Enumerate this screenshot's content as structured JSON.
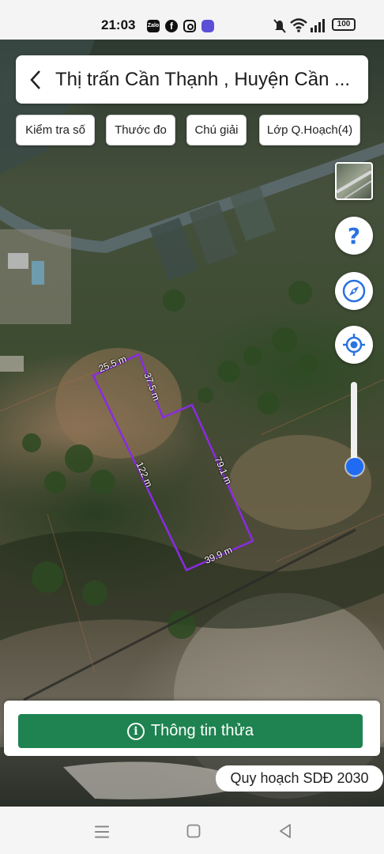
{
  "status_bar": {
    "time": "21:03",
    "app_icons": [
      "zalo-icon",
      "facebook-icon",
      "instagram-icon",
      "cloud-app-icon"
    ],
    "zalo_label": "Zalo",
    "battery": "100",
    "indicators": [
      "mute-icon",
      "wifi-icon",
      "signal-icon",
      "battery-icon"
    ]
  },
  "header": {
    "back_icon": "chevron-left-icon",
    "title": "Thị trấn Cần Thạnh , Huyện Cần ..."
  },
  "toolbar": {
    "chips": [
      "Kiểm tra số",
      "Thước đo",
      "Chú giải",
      "Lớp Q.Hoạch(4)"
    ]
  },
  "map": {
    "parcel_color": "#8a2be2",
    "measurements": {
      "top_left": "25.5 m",
      "inner_top": "37.5 m",
      "left_side": "122 m",
      "right_side": "79.1 m",
      "bottom": "39.9 m"
    },
    "controls": [
      "layers-thumbnail",
      "help-icon",
      "compass-icon",
      "my-location-icon"
    ],
    "zoom_level": 0.12
  },
  "bottom": {
    "info_button": "Thông tin thửa",
    "plan_badge": "Quy hoạch SDĐ 2030"
  },
  "nav": [
    "menu-icon",
    "home-icon",
    "back-icon"
  ],
  "colors": {
    "primary_green": "#1e8350",
    "accent_blue": "#1f6bf2",
    "parcel_outline": "#8a2be2"
  }
}
